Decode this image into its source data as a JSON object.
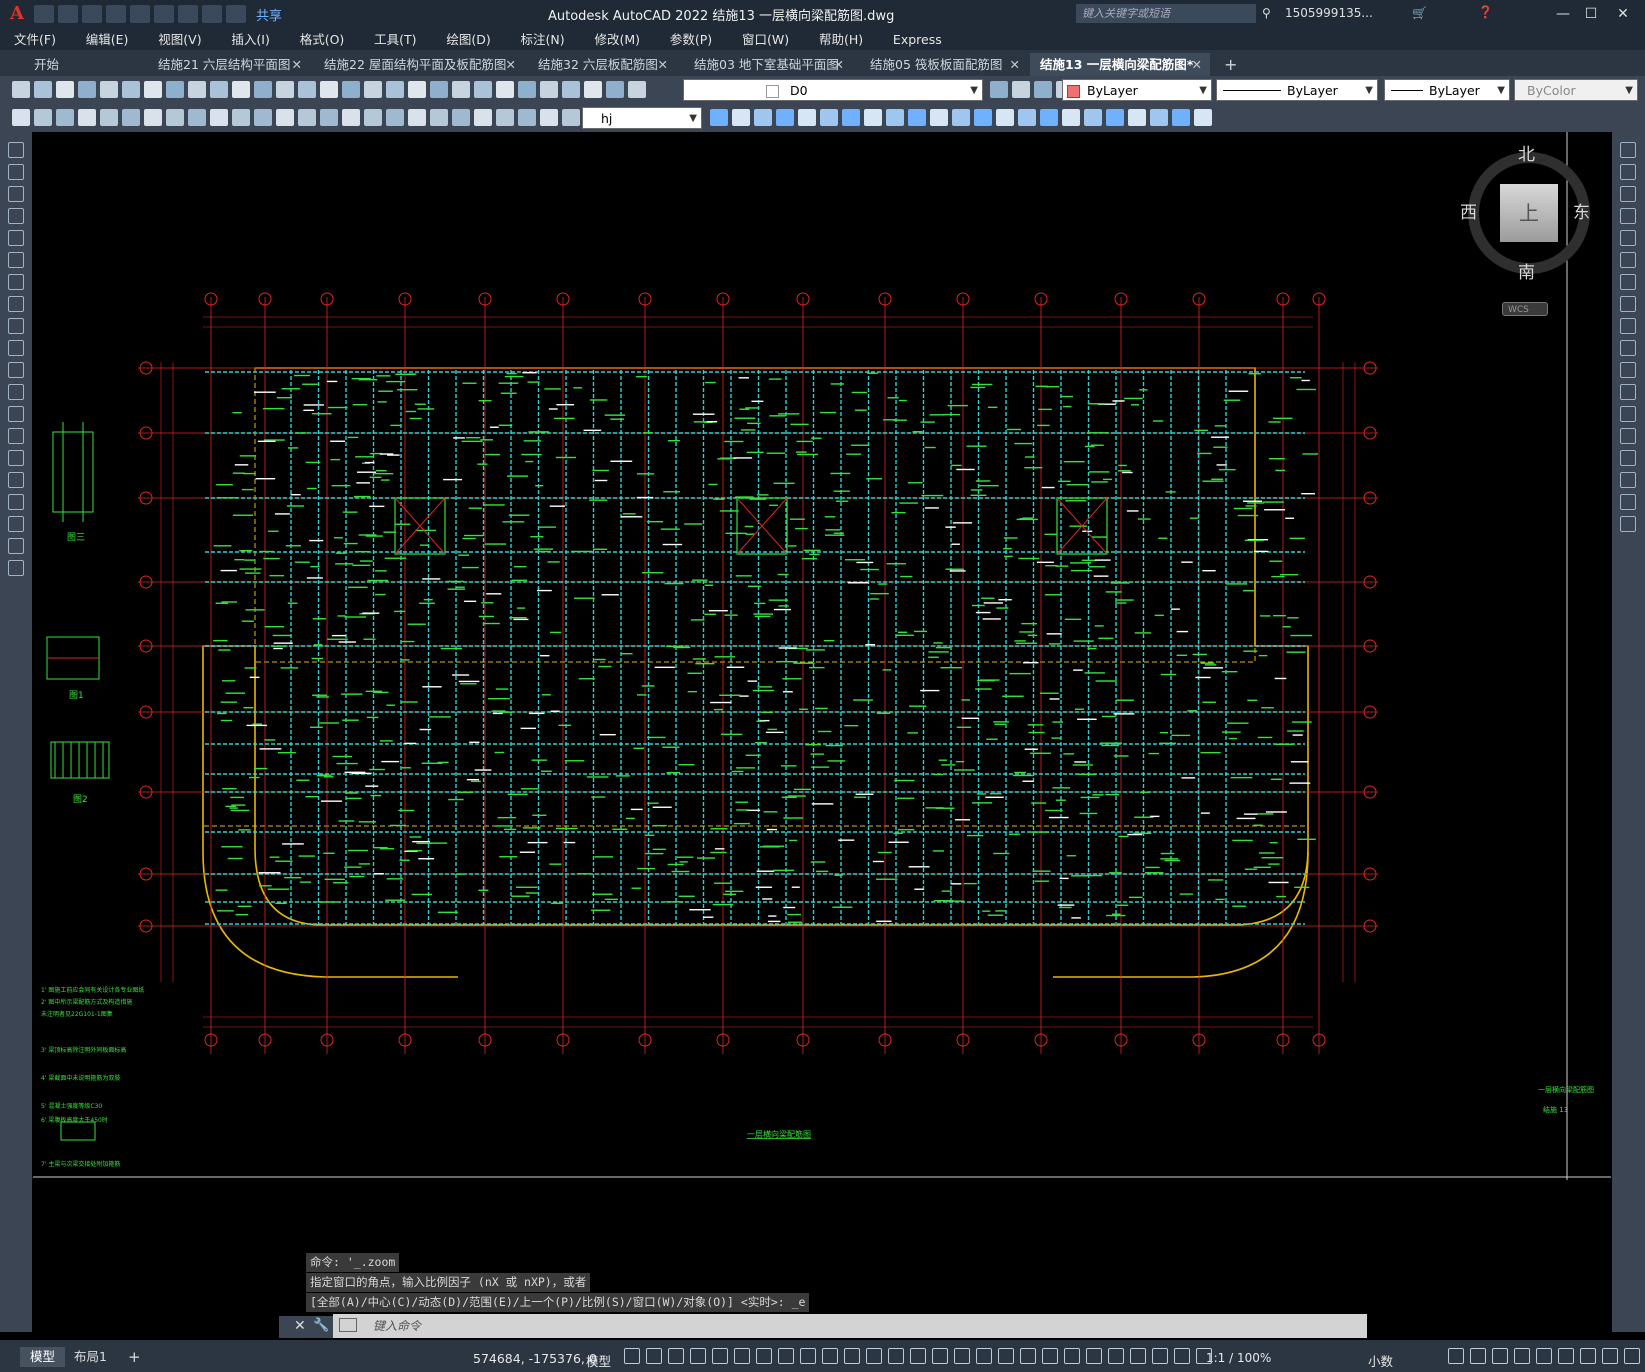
{
  "app": {
    "title": "Autodesk AutoCAD 2022    结施13 一层横向梁配筋图.dwg",
    "search_placeholder": "键入关键字或短语",
    "user": "1505999135...",
    "share": "共享",
    "logo": "A"
  },
  "menu": [
    "文件(F)",
    "编辑(E)",
    "视图(V)",
    "插入(I)",
    "格式(O)",
    "工具(T)",
    "绘图(D)",
    "标注(N)",
    "修改(M)",
    "参数(P)",
    "窗口(W)",
    "帮助(H)",
    "Express"
  ],
  "tabs": [
    {
      "label": "开始"
    },
    {
      "label": "结施21 六层结构平面图"
    },
    {
      "label": "结施22 屋面结构平面及板配筋图"
    },
    {
      "label": "结施32 六层板配筋图"
    },
    {
      "label": "结施03 地下室基础平面图"
    },
    {
      "label": "结施05 筏板板面配筋图"
    },
    {
      "label": "结施13 一层横向梁配筋图*"
    }
  ],
  "layer_props": {
    "layer": "D0",
    "color": "ByLayer",
    "linetype": "ByLayer",
    "lineweight": "ByLayer",
    "plotstyle": "ByColor",
    "textstyle": "hj"
  },
  "viewcube": {
    "north": "北",
    "south": "南",
    "east": "东",
    "west": "西",
    "face": "上",
    "wcs": "WCS"
  },
  "drawing": {
    "title": "一层横向梁配筋图",
    "detail_label_3": "图三",
    "detail_label_1": "图1",
    "detail_label_2": "图2",
    "sheet_label": "结施 13",
    "sheet_desc": "一层横向梁配筋图",
    "notes": [
      "1' 图施工前应会同有关设计各专业图纸",
      "2' 图中所示梁配筋方式及构造措施",
      "   未注明者见22G101-1图集",
      "3' 梁顶标高除注明外同板面标高",
      "4' 梁截面中未说明箍筋为双肢",
      "5' 混凝土强度等级C30",
      "6' 梁腹板高度大于450时",
      "7' 主梁与次梁交接处附加箍筋"
    ],
    "colors": {
      "axis": "#e0261f",
      "beam": "#2fd0d0",
      "wall": "#e8b800",
      "rebar": "#36e23a",
      "dim": "#e0261f"
    }
  },
  "command": {
    "history": [
      "命令: '_.zoom",
      "指定窗口的角点，输入比例因子 (nX 或 nXP)，或者",
      "[全部(A)/中心(C)/动态(D)/范围(E)/上一个(P)/比例(S)/窗口(W)/对象(O)] <实时>: _e"
    ],
    "placeholder": "键入命令"
  },
  "status": {
    "tabs": [
      "模型",
      "布局1"
    ],
    "coords": "574684, -175376, 0",
    "space": "模型",
    "scale": "1:1 / 100%",
    "units": "小数"
  }
}
